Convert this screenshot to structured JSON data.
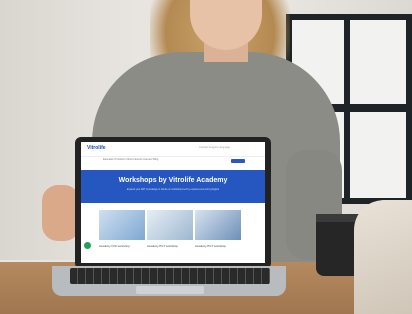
{
  "website": {
    "logo_text": "Vitrolife",
    "menu_text": "Education   Products   Clinics   Events   Careers   Blog",
    "util_text": "Contact   Support   Language",
    "hero_title": "Workshops by Vitrolife Academy",
    "hero_subtitle": "Expand your ART knowledge in hands-on workshops led by experienced embryologists",
    "cards": [
      {
        "label": "Academy ICSI workshop"
      },
      {
        "label": "Academy PGT workshop"
      },
      {
        "label": "Academy PGT workshop"
      }
    ]
  },
  "scene": {
    "icons": [
      "laptop-icon",
      "coffee-cup-icon",
      "chat-bubble-icon"
    ]
  }
}
